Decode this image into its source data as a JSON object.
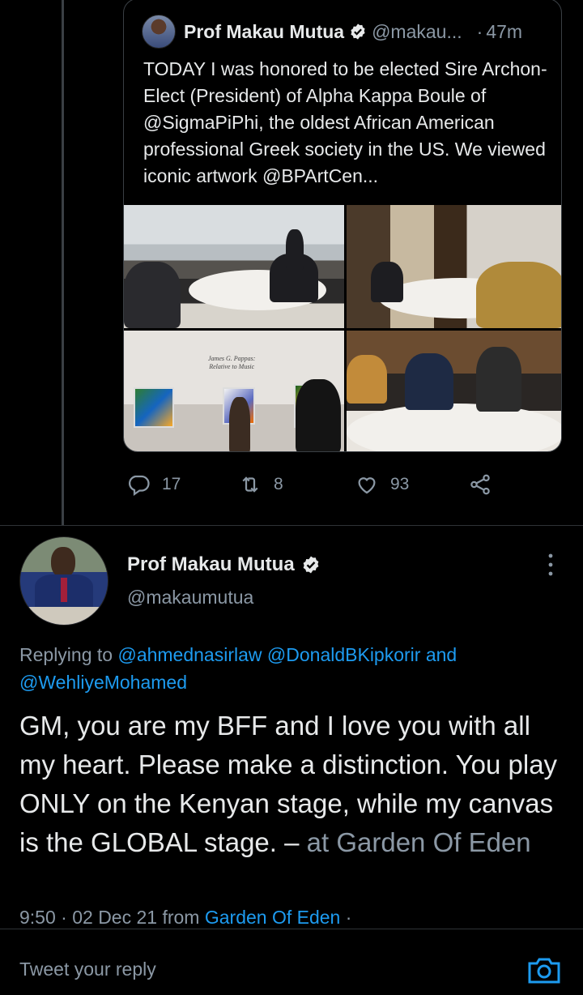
{
  "quoted_tweet": {
    "author_name": "Prof Makau Mutua",
    "handle": "@makau...",
    "separator": "·",
    "time": "47m",
    "text": "TODAY I was honored to be elected Sire Archon-Elect (President) of Alpha Kappa Boule of @SigmaPiPhi, the oldest African American professional Greek society in the US.  We viewed iconic artwork @BPArtCen...",
    "photo_caption_line1": "James G. Pappas:",
    "photo_caption_line2": "Relative to Music",
    "actions": {
      "replies": "17",
      "retweets": "8",
      "likes": "93"
    }
  },
  "main_tweet": {
    "author_name": "Prof Makau Mutua",
    "handle": "@makaumutua",
    "replying_prefix": "Replying to",
    "replying_to": [
      "@ahmednasirlaw",
      "@DonaldBKipkorir",
      "@WehliyeMohamed"
    ],
    "replying_and": "and",
    "body": "GM, you are my BFF and I love you with all my heart.  Please make a distinction. You play ONLY on the Kenyan stage, while my canvas is the GLOBAL stage. –",
    "location_text": "at Garden Of Eden",
    "time": "9:50",
    "dot": "·",
    "date": "02 Dec 21",
    "from_label": "from",
    "source": "Garden Of Eden",
    "trailing_dot": "·"
  },
  "reply_bar": {
    "placeholder": "Tweet your reply"
  },
  "colors": {
    "background": "#000000",
    "text": "#e7e9ea",
    "muted": "#8b98a5",
    "link": "#1d9bf0",
    "border": "#2f3336"
  },
  "icons": [
    "verified-badge-icon",
    "reply-icon",
    "retweet-icon",
    "like-icon",
    "share-icon",
    "more-icon",
    "camera-icon"
  ]
}
